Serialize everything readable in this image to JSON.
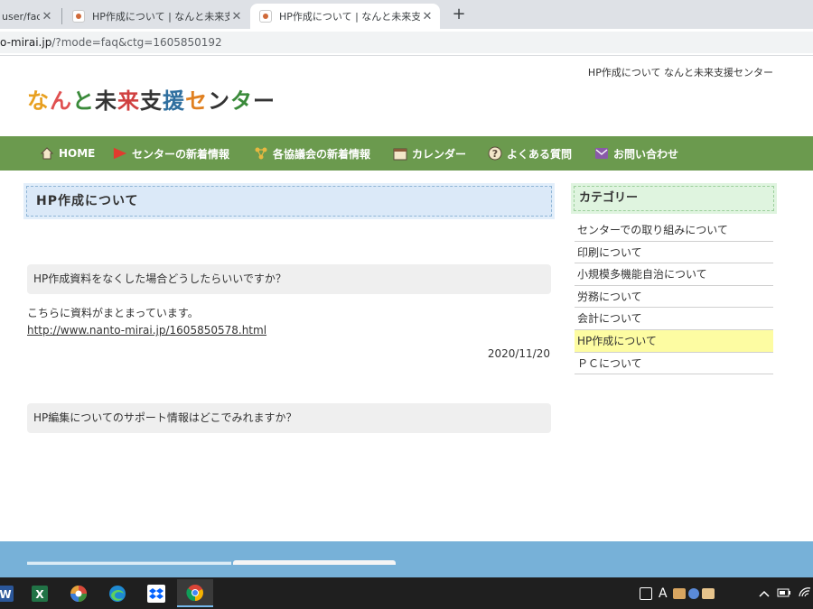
{
  "browser": {
    "tabs": [
      {
        "title": "user/faq",
        "active": false
      },
      {
        "title": "HP作成について | なんと未来支援セ",
        "active": false
      },
      {
        "title": "HP作成について | なんと未来支援セ",
        "active": true
      }
    ],
    "close_glyph": "✕",
    "new_tab_glyph": "+",
    "url_host": "o-mirai.jp",
    "url_path": "/?mode=faq&ctg=1605850192"
  },
  "site": {
    "header_text": "HP作成について なんと未来支援センター",
    "logo_chars": [
      {
        "ch": "な",
        "color": "#e8a020"
      },
      {
        "ch": "ん",
        "color": "#e05050"
      },
      {
        "ch": "と",
        "color": "#3a8a3a"
      },
      {
        "ch": "未",
        "color": "#333333"
      },
      {
        "ch": "来",
        "color": "#d04040"
      },
      {
        "ch": "支",
        "color": "#333333"
      },
      {
        "ch": "援",
        "color": "#2f6f9f"
      },
      {
        "ch": "セ",
        "color": "#e08020"
      },
      {
        "ch": "ン",
        "color": "#333333"
      },
      {
        "ch": "タ",
        "color": "#3a8a3a"
      },
      {
        "ch": "ー",
        "color": "#333333"
      }
    ]
  },
  "nav": {
    "items": [
      {
        "label": "HOME",
        "icon": "home-icon"
      },
      {
        "label": "センターの新着情報",
        "icon": "flag-icon"
      },
      {
        "label": "各協議会の新着情報",
        "icon": "network-icon"
      },
      {
        "label": "カレンダー",
        "icon": "calendar-icon"
      },
      {
        "label": "よくある質問",
        "icon": "question-icon"
      },
      {
        "label": "お問い合わせ",
        "icon": "mail-icon"
      }
    ]
  },
  "main": {
    "title": "HP作成について",
    "faqs": [
      {
        "question": "HP作成資料をなくした場合どうしたらいいですか？",
        "answer_text": "こちらに資料がまとまっています。",
        "answer_link": "http://www.nanto-mirai.jp/1605850578.html",
        "date": "2020/11/20"
      },
      {
        "question": "HP編集についてのサポート情報はどこでみれますか？"
      }
    ]
  },
  "sidebar": {
    "heading": "カテゴリー",
    "items": [
      {
        "label": "センターでの取り組みについて",
        "active": false
      },
      {
        "label": "印刷について",
        "active": false
      },
      {
        "label": "小規模多機能自治について",
        "active": false
      },
      {
        "label": "労務について",
        "active": false
      },
      {
        "label": "会計について",
        "active": false
      },
      {
        "label": "HP作成について",
        "active": true
      },
      {
        "label": "ＰＣについて",
        "active": false
      }
    ]
  },
  "taskbar": {
    "apps": [
      "word-icon",
      "excel-icon",
      "photos-icon",
      "edge-icon",
      "dropbox-icon",
      "chrome-icon"
    ],
    "tray_ime": "A",
    "colors": {
      "accent": "#76b9ed"
    }
  },
  "colors": {
    "nav_bg": "#6b9a4e",
    "title_bg": "#dbe9f8",
    "category_bg": "#dff4df",
    "active_category": "#fdfca2",
    "footer": "#77b1d8"
  }
}
